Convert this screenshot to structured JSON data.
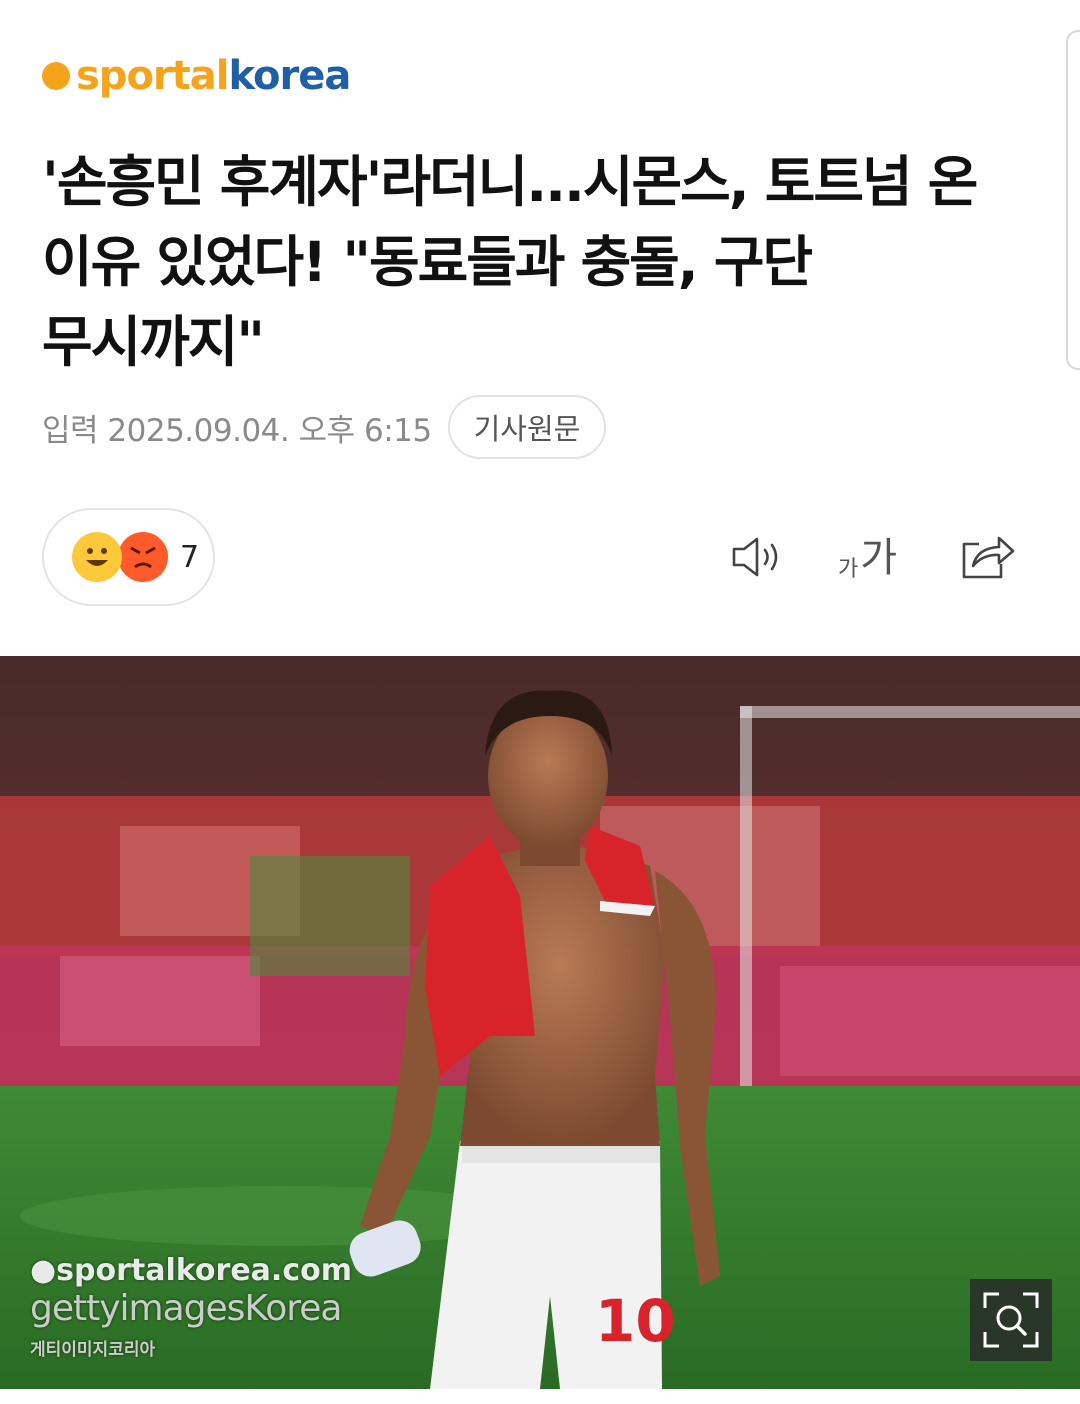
{
  "logo": {
    "part1": "sportal",
    "part2": "korea"
  },
  "headline": "'손흥민 후계자'라더니...시몬스, 토트넘 온 이유 있었다! \"동료들과 충돌, 구단 무시까지\"",
  "meta": {
    "date": "입력 2025.09.04. 오후 6:15",
    "original_button": "기사원문"
  },
  "reactions": {
    "count": "7",
    "icons": [
      "happy-face-icon",
      "angry-face-icon"
    ]
  },
  "toolbar": {
    "font_small": "가",
    "font_large": "가",
    "icons": [
      "speaker-icon",
      "font-size-icon",
      "share-icon"
    ]
  },
  "photo": {
    "watermark_site": "●sportalkorea.com",
    "watermark_getty": "gettyimagesKorea",
    "watermark_korean": "게티이미지코리아",
    "jersey_number": "10"
  },
  "colors": {
    "brand_orange": "#f5a31a",
    "brand_blue": "#1f5fa8"
  }
}
